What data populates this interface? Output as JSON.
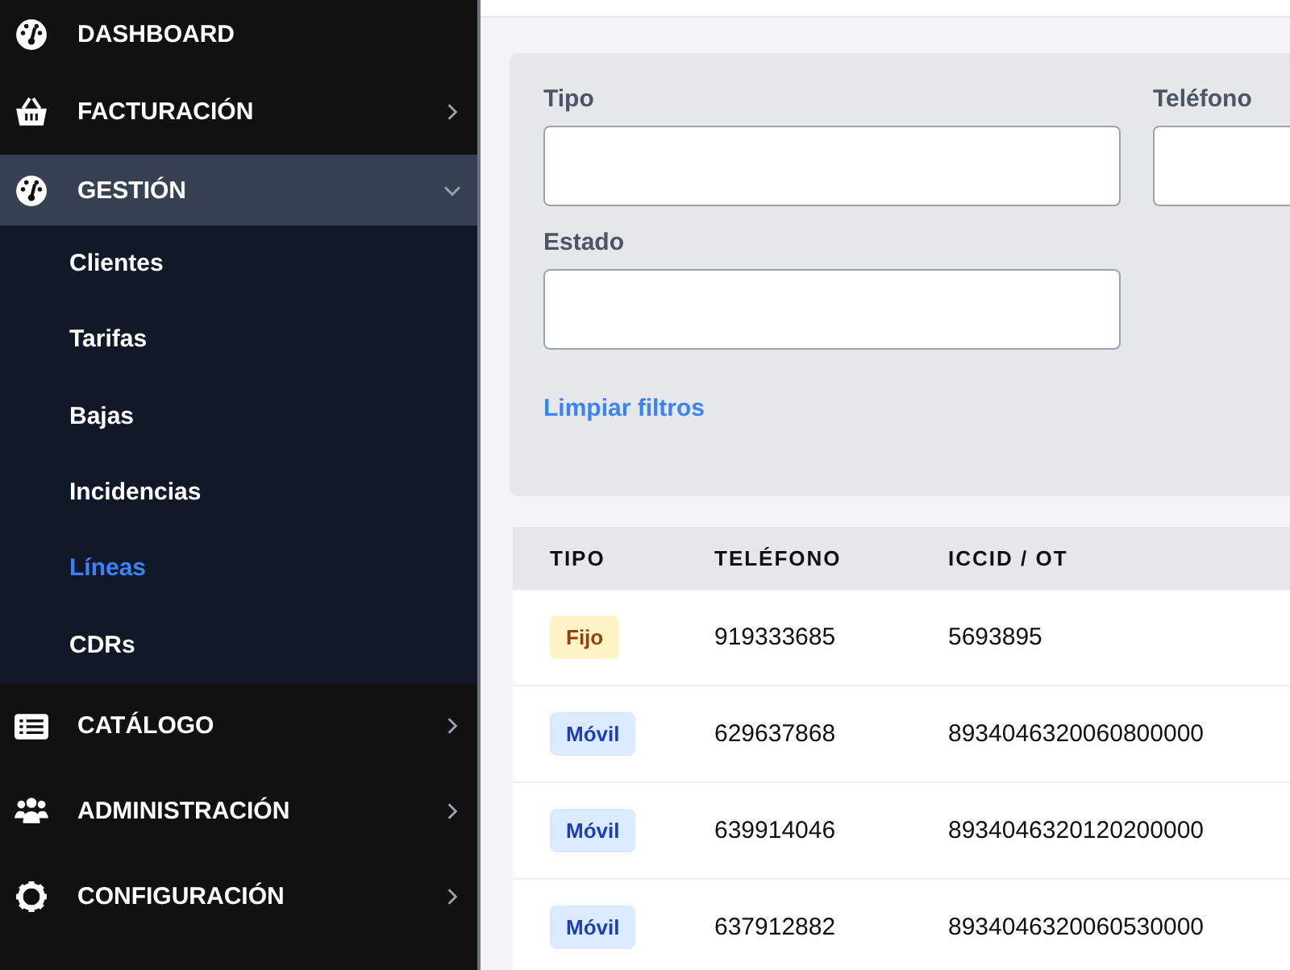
{
  "sidebar": {
    "items": [
      {
        "label": "DASHBOARD",
        "has_chevron": false,
        "expanded": false
      },
      {
        "label": "FACTURACIÓN",
        "has_chevron": true,
        "expanded": false
      },
      {
        "label": "GESTIÓN",
        "has_chevron": true,
        "expanded": true,
        "children": [
          {
            "label": "Clientes",
            "selected": false
          },
          {
            "label": "Tarifas",
            "selected": false
          },
          {
            "label": "Bajas",
            "selected": false
          },
          {
            "label": "Incidencias",
            "selected": false
          },
          {
            "label": "Líneas",
            "selected": true
          },
          {
            "label": "CDRs",
            "selected": false
          }
        ]
      },
      {
        "label": "CATÁLOGO",
        "has_chevron": true,
        "expanded": false
      },
      {
        "label": "ADMINISTRACIÓN",
        "has_chevron": true,
        "expanded": false
      },
      {
        "label": "CONFIGURACIÓN",
        "has_chevron": true,
        "expanded": false
      }
    ]
  },
  "filters": {
    "fields": [
      {
        "label": "Tipo"
      },
      {
        "label": "Teléfono"
      },
      {
        "label": "Estado"
      }
    ],
    "clear_link": "Limpiar filtros"
  },
  "table": {
    "columns": [
      "TIPO",
      "TELÉFONO",
      "ICCID / OT"
    ],
    "rows": [
      {
        "type": {
          "text": "Fijo",
          "kind": "fixed"
        },
        "phone": "919333685",
        "iccid": "5693895"
      },
      {
        "type": {
          "text": "Móvil",
          "kind": "mobile"
        },
        "phone": "629637868",
        "iccid": "8934046320060800000"
      },
      {
        "type": {
          "text": "Móvil",
          "kind": "mobile"
        },
        "phone": "639914046",
        "iccid": "8934046320120200000"
      },
      {
        "type": {
          "text": "Móvil",
          "kind": "mobile"
        },
        "phone": "637912882",
        "iccid": "8934046320060530000"
      }
    ]
  }
}
